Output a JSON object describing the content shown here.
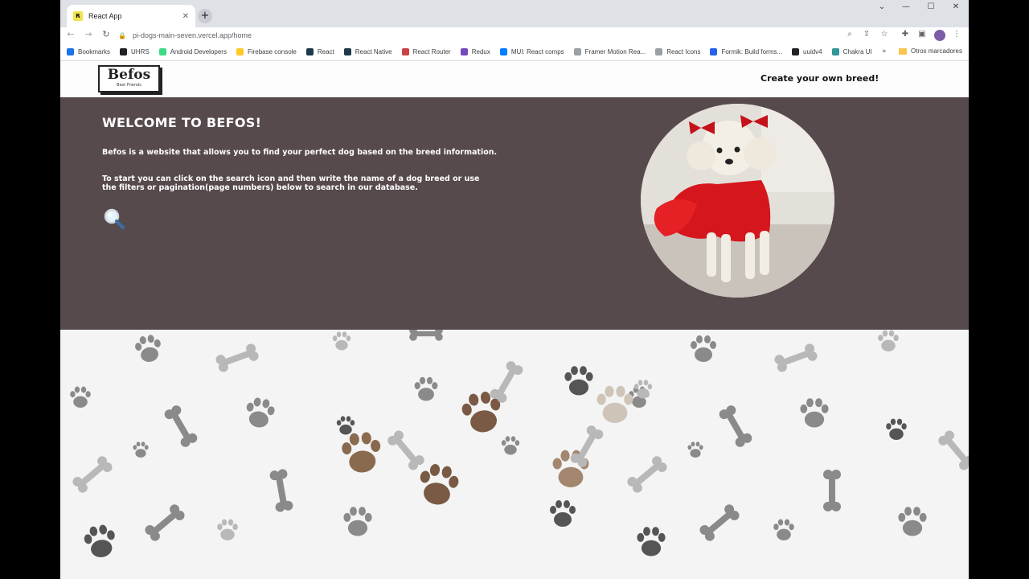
{
  "browser": {
    "tab_title": "React App",
    "tab_favicon_text": "R",
    "url": "pi-dogs-main-seven.vercel.app/home",
    "bookmarks": [
      {
        "label": "Bookmarks",
        "color": "#1a73e8"
      },
      {
        "label": "UHRS",
        "color": "#202124"
      },
      {
        "label": "Android Developers",
        "color": "#3ddc84"
      },
      {
        "label": "Firebase console",
        "color": "#ffca28"
      },
      {
        "label": "React",
        "color": "#1e3a4a"
      },
      {
        "label": "React Native",
        "color": "#1e3a4a"
      },
      {
        "label": "React Router",
        "color": "#ca4245"
      },
      {
        "label": "Redux",
        "color": "#764abc"
      },
      {
        "label": "MUI: React comps",
        "color": "#007fff"
      },
      {
        "label": "Framer Motion Rea...",
        "color": "#9aa0a6"
      },
      {
        "label": "React Icons",
        "color": "#9aa0a6"
      },
      {
        "label": "Formik: Build forms...",
        "color": "#2563eb"
      },
      {
        "label": "uuidv4",
        "color": "#202124"
      },
      {
        "label": "Chakra UI",
        "color": "#319795"
      }
    ],
    "other_bookmarks": "Otros marcadores",
    "more_bookmarks": "»"
  },
  "header": {
    "logo_name": "Befos",
    "logo_tagline": "Best Friends",
    "create_link": "Create your own breed!"
  },
  "hero": {
    "title": "WELCOME TO BEFOS!",
    "paragraph_1": "Befos is a website that allows you to find your perfect dog based on the breed information.",
    "paragraph_2": "To start you can click on the search icon and then write the name of a dog breed or use the filters or pagination(page numbers) below to search in our database."
  },
  "colors": {
    "hero_bg": "#574a4c",
    "pattern_bg": "#f4f4f4",
    "paw_gray": "#8a8a8a",
    "paw_brown": "#7a5a44"
  }
}
